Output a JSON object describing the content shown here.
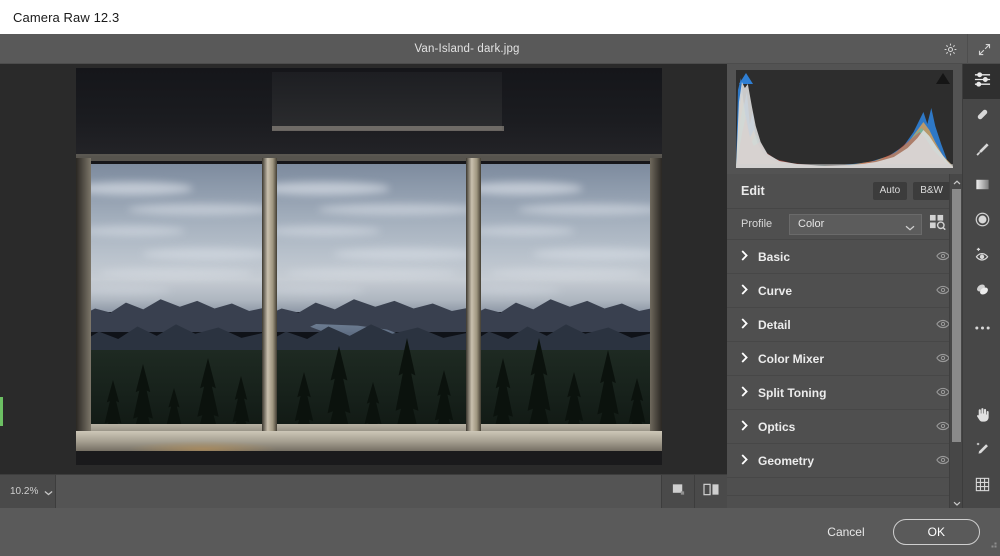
{
  "window": {
    "os_title": "Camera Raw 12.3",
    "document_title": "Van-Island- dark.jpg"
  },
  "header": {
    "settings_icon": "gear-icon",
    "fullscreen_icon": "expand-arrows-icon"
  },
  "canvas": {
    "zoom_level": "10.2%",
    "zoom_chevron_icon": "chevron-down-icon",
    "view_single_icon": "single-view-icon",
    "view_before_after_icon": "before-after-view-icon"
  },
  "toolrail": {
    "tools": [
      {
        "name": "edit-sliders-tool",
        "icon": "sliders-icon",
        "active": true
      },
      {
        "name": "spot-removal-tool",
        "icon": "healing-brush-icon",
        "active": false
      },
      {
        "name": "adjustment-brush-tool",
        "icon": "paintbrush-icon",
        "active": false
      },
      {
        "name": "graduated-filter-tool",
        "icon": "gradient-square-icon",
        "active": false
      },
      {
        "name": "radial-filter-tool",
        "icon": "radial-circle-icon",
        "active": false
      },
      {
        "name": "red-eye-tool",
        "icon": "red-eye-icon",
        "active": false
      },
      {
        "name": "snapshots-tool",
        "icon": "overlapping-ovals-icon",
        "active": false
      },
      {
        "name": "more-options",
        "icon": "ellipsis-icon",
        "active": false
      }
    ],
    "bottom_tools": [
      {
        "name": "hand-tool",
        "icon": "hand-icon"
      },
      {
        "name": "white-balance-tool",
        "icon": "eyedropper-icon"
      },
      {
        "name": "crop-tool",
        "icon": "grid-crop-icon"
      }
    ]
  },
  "histogram": {
    "shadow_clipping_icon": "shadow-clipping-triangle",
    "highlight_clipping_icon": "highlight-clipping-triangle",
    "shadow_clipping_color": "#2f7fd4",
    "highlight_clipping_color": "#151515"
  },
  "edit_panel": {
    "title": "Edit",
    "auto_label": "Auto",
    "bw_label": "B&W",
    "profile_label": "Profile",
    "profile_value": "Color",
    "profile_chevron_icon": "chevron-down-icon",
    "browse_profiles_icon": "browse-profiles-icon",
    "sections": [
      {
        "label": "Basic",
        "chevron_icon": "chevron-right-icon",
        "visibility_icon": "eye-icon"
      },
      {
        "label": "Curve",
        "chevron_icon": "chevron-right-icon",
        "visibility_icon": "eye-icon"
      },
      {
        "label": "Detail",
        "chevron_icon": "chevron-right-icon",
        "visibility_icon": "eye-icon"
      },
      {
        "label": "Color Mixer",
        "chevron_icon": "chevron-right-icon",
        "visibility_icon": "eye-icon"
      },
      {
        "label": "Split Toning",
        "chevron_icon": "chevron-right-icon",
        "visibility_icon": "eye-icon"
      },
      {
        "label": "Optics",
        "chevron_icon": "chevron-right-icon",
        "visibility_icon": "eye-icon"
      },
      {
        "label": "Geometry",
        "chevron_icon": "chevron-right-icon",
        "visibility_icon": "eye-icon"
      }
    ],
    "scroll_up_icon": "chevron-up-icon",
    "scroll_down_icon": "chevron-down-icon"
  },
  "footer": {
    "cancel_label": "Cancel",
    "ok_label": "OK"
  }
}
